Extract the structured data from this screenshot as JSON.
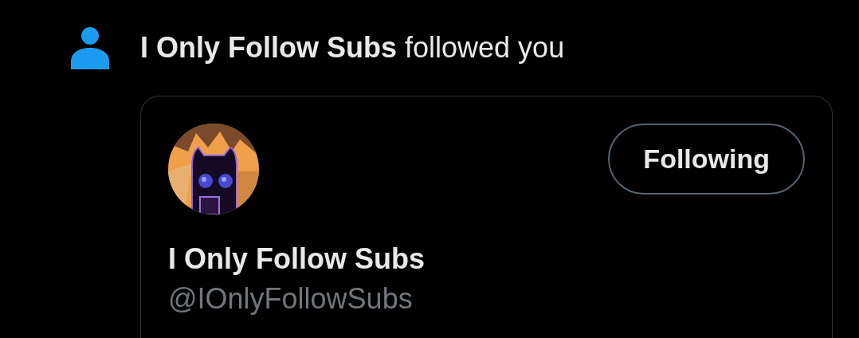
{
  "notification": {
    "actor": "I Only Follow Subs",
    "action": "followed you"
  },
  "card": {
    "button": {
      "label": "Following",
      "following": true
    },
    "name": "I Only Follow Subs",
    "handle": "@IOnlyFollowSubs"
  }
}
